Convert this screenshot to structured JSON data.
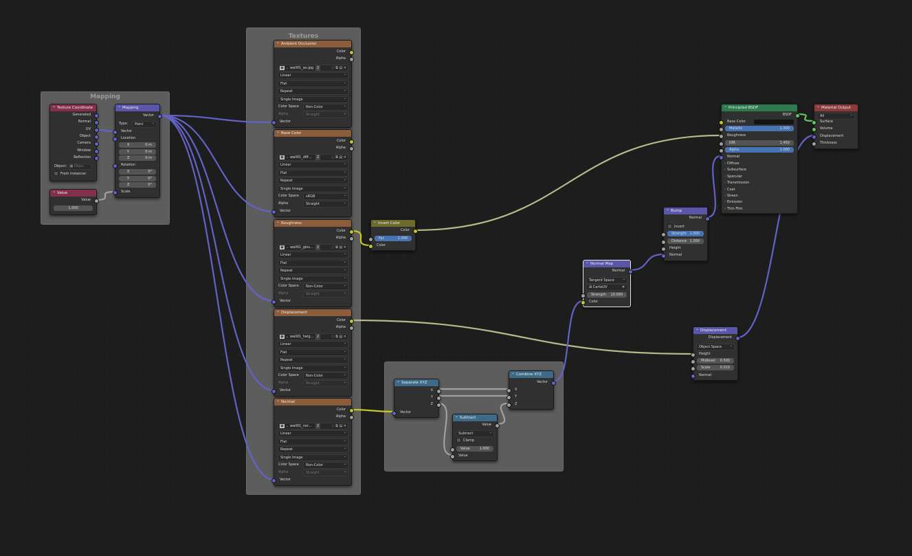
{
  "frames": {
    "mapping": "Mapping",
    "textures": "Textures"
  },
  "texture_coordinate": {
    "title": "Texture Coordinate",
    "outputs": [
      "Generated",
      "Normal",
      "UV",
      "Object",
      "Camera",
      "Window",
      "Reflection"
    ],
    "object_label": "Object:",
    "object_placeholder": "Objec",
    "from_instancer": "From Instancer"
  },
  "value_node": {
    "title": "Value",
    "output": "Value",
    "value": "1.000"
  },
  "mapping": {
    "title": "Mapping",
    "output": "Vector",
    "type_label": "Type:",
    "type_value": "Point",
    "vector": "Vector",
    "location": "Location",
    "loc": [
      {
        "k": "X",
        "v": "0 m"
      },
      {
        "k": "Y",
        "v": "0 m"
      },
      {
        "k": "Z",
        "v": "0 m"
      }
    ],
    "rotation": "Rotation",
    "rot": [
      {
        "k": "X",
        "v": "0°"
      },
      {
        "k": "Y",
        "v": "0°"
      },
      {
        "k": "Z",
        "v": "0°"
      }
    ],
    "scale": "Scale"
  },
  "image_nodes": [
    {
      "title": "Ambient Occlusion",
      "file": "wall01_ao.jpg",
      "users": "2",
      "interp": "Linear",
      "proj": "Flat",
      "ext": "Repeat",
      "source": "Single Image",
      "cs_label": "Color Space",
      "cs": "Non-Color",
      "alpha_label": "Alpha",
      "alpha": "Straight",
      "alpha_dim": true
    },
    {
      "title": "Base Color",
      "file": "wall01_diff...",
      "users": "2",
      "interp": "Linear",
      "proj": "Flat",
      "ext": "Repeat",
      "source": "Single Image",
      "cs_label": "Color Space",
      "cs": "sRGB",
      "alpha_label": "Alpha",
      "alpha": "Straight",
      "alpha_dim": false
    },
    {
      "title": "Roughness",
      "file": "wall01_glos...",
      "users": "2",
      "interp": "Linear",
      "proj": "Flat",
      "ext": "Repeat",
      "source": "Single Image",
      "cs_label": "Color Space",
      "cs": "Non-Color",
      "alpha_label": "Alpha",
      "alpha": "Straight",
      "alpha_dim": true
    },
    {
      "title": "Displacement",
      "file": "wall01_heig...",
      "users": "2",
      "interp": "Linear",
      "proj": "Flat",
      "ext": "Repeat",
      "source": "Single Image",
      "cs_label": "Color Space",
      "cs": "Non-Color",
      "alpha_label": "Alpha",
      "alpha": "Straight",
      "alpha_dim": true
    },
    {
      "title": "Normal",
      "file": "wall01_nor...",
      "users": "2",
      "interp": "Linear",
      "proj": "Flat",
      "ext": "Repeat",
      "source": "Single Image",
      "cs_label": "Color Space",
      "cs": "Non-Color",
      "alpha_label": "Alpha",
      "alpha": "Straight",
      "alpha_dim": true
    }
  ],
  "image_socket_labels": {
    "color": "Color",
    "alpha": "Alpha",
    "vector": "Vector"
  },
  "invert": {
    "title": "Invert Color",
    "output": "Color",
    "fac_label": "Fac",
    "fac": "1.000",
    "color": "Color"
  },
  "separate": {
    "title": "Separate XYZ",
    "outputs": [
      "X",
      "Y",
      "Z"
    ],
    "input": "Vector"
  },
  "combine": {
    "title": "Combine XYZ",
    "output": "Vector",
    "inputs": [
      "X",
      "Y",
      "Z"
    ]
  },
  "subtract": {
    "title": "Subtract",
    "output": "Value",
    "op": "Subtract",
    "clamp": "Clamp",
    "value_label": "Value",
    "value": "1.000",
    "input": "Value"
  },
  "normal_map": {
    "title": "Normal Map",
    "output": "Normal",
    "space": "Tangent Space",
    "uv": "CarteUV",
    "strength_label": "Strength",
    "strength": "10.000",
    "color": "Color"
  },
  "bump": {
    "title": "Bump",
    "output": "Normal",
    "invert": "Invert",
    "strength_label": "Strength",
    "strength": "1.000",
    "distance_label": "Distance",
    "distance": "1.000",
    "height": "Height",
    "normal": "Normal"
  },
  "displacement": {
    "title": "Displacement",
    "output": "Displacement",
    "space": "Object Space",
    "height": "Height",
    "midlevel_label": "Midlevel",
    "midlevel": "0.500",
    "scale_label": "Scale",
    "scale": "0.010",
    "normal": "Normal"
  },
  "bsdf": {
    "title": "Principled BSDF",
    "output": "BSDF",
    "base_color": "Base Color",
    "metallic_label": "Metallic",
    "metallic": "1.000",
    "roughness": "Roughness",
    "ior_label": "IOR",
    "ior": "1.450",
    "alpha_label": "Alpha",
    "alpha": "1.000",
    "normal": "Normal",
    "panels": [
      "Diffuse",
      "Subsurface",
      "Specular",
      "Transmission",
      "Coat",
      "Sheen",
      "Emission",
      "Thin Film"
    ]
  },
  "material_output": {
    "title": "Material Output",
    "target": "All",
    "inputs": [
      "Surface",
      "Volume",
      "Displacement",
      "Thickness"
    ]
  },
  "colors": {
    "yellow": "#c7c729",
    "gray": "#a1a1a1",
    "vector": "#6363c7",
    "shader": "#63c763"
  }
}
